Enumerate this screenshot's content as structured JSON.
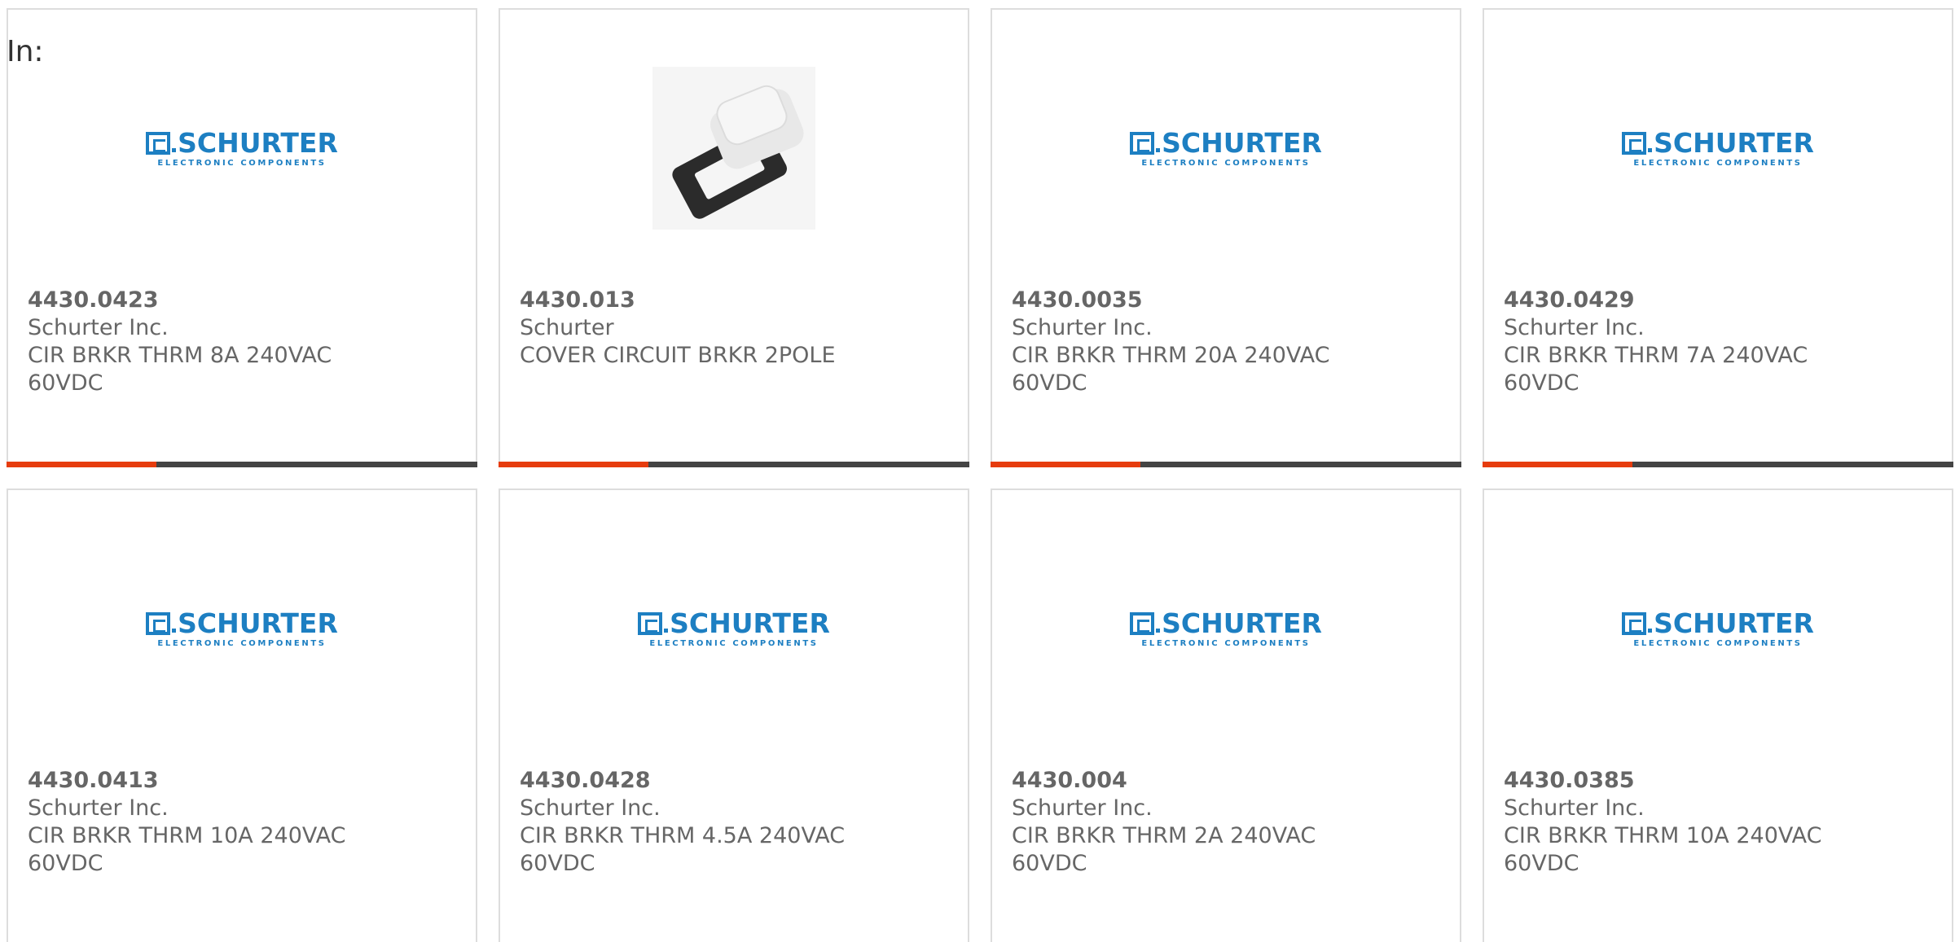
{
  "filter_label": "In:",
  "colors": {
    "accent": "#e63c0e",
    "bar": "#444444",
    "brand": "#1d7fc2"
  },
  "brand_logo": {
    "name": "SCHURTER",
    "tagline": "ELECTRONIC COMPONENTS"
  },
  "products": [
    {
      "part_number": "4430.0423",
      "manufacturer": "Schurter Inc.",
      "desc_line1": "CIR BRKR THRM 8A 240VAC",
      "desc_line2": "60VDC",
      "image": "logo"
    },
    {
      "part_number": "4430.013",
      "manufacturer": "Schurter",
      "desc_line1": "COVER CIRCUIT BRKR 2POLE",
      "desc_line2": "",
      "image": "photo"
    },
    {
      "part_number": "4430.0035",
      "manufacturer": "Schurter Inc.",
      "desc_line1": "CIR BRKR THRM 20A 240VAC",
      "desc_line2": "60VDC",
      "image": "logo"
    },
    {
      "part_number": "4430.0429",
      "manufacturer": "Schurter Inc.",
      "desc_line1": "CIR BRKR THRM 7A 240VAC",
      "desc_line2": "60VDC",
      "image": "logo"
    },
    {
      "part_number": "4430.0413",
      "manufacturer": "Schurter Inc.",
      "desc_line1": "CIR BRKR THRM 10A 240VAC",
      "desc_line2": "60VDC",
      "image": "logo"
    },
    {
      "part_number": "4430.0428",
      "manufacturer": "Schurter Inc.",
      "desc_line1": "CIR BRKR THRM 4.5A 240VAC",
      "desc_line2": "60VDC",
      "image": "logo"
    },
    {
      "part_number": "4430.004",
      "manufacturer": "Schurter Inc.",
      "desc_line1": "CIR BRKR THRM 2A 240VAC",
      "desc_line2": "60VDC",
      "image": "logo"
    },
    {
      "part_number": "4430.0385",
      "manufacturer": "Schurter Inc.",
      "desc_line1": "CIR BRKR THRM 10A 240VAC",
      "desc_line2": "60VDC",
      "image": "logo"
    }
  ]
}
